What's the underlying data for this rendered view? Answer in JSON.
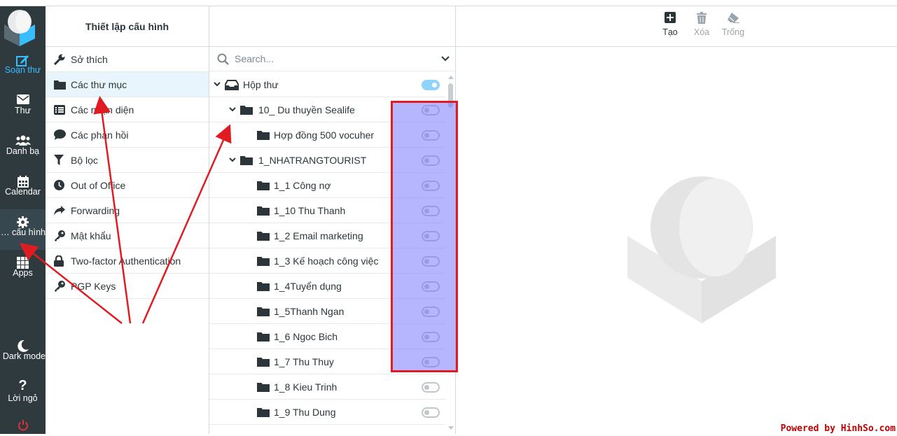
{
  "nav": {
    "items": [
      {
        "label": "Soạn thư",
        "icon": "compose-icon"
      },
      {
        "label": "Thư",
        "icon": "mail-icon"
      },
      {
        "label": "Danh bạ",
        "icon": "contacts-icon"
      },
      {
        "label": "Calendar",
        "icon": "calendar-icon"
      },
      {
        "label": "Thiết lập cấu hình",
        "icon": "gear-icon"
      },
      {
        "label": "Apps",
        "icon": "apps-icon"
      }
    ],
    "dark_mode": "Dark mode",
    "help": "Lời ngỏ",
    "logout_icon": "power-icon"
  },
  "settings": {
    "title": "Thiết lập cấu hình",
    "items": [
      {
        "label": "Sở thích",
        "icon": "wrench-icon"
      },
      {
        "label": "Các thư mục",
        "icon": "folder-icon"
      },
      {
        "label": "Các nhận diện",
        "icon": "identity-list-icon"
      },
      {
        "label": "Các phản hồi",
        "icon": "comment-icon"
      },
      {
        "label": "Bộ lọc",
        "icon": "filter-icon"
      },
      {
        "label": "Out of Office",
        "icon": "clock-icon"
      },
      {
        "label": "Forwarding",
        "icon": "forward-icon"
      },
      {
        "label": "Mật khẩu",
        "icon": "key-icon"
      },
      {
        "label": "Two-factor Authentication",
        "icon": "lock-icon"
      },
      {
        "label": "PGP Keys",
        "icon": "key-icon"
      }
    ]
  },
  "folders": {
    "search_placeholder": "Search...",
    "rows": [
      {
        "name": "Hộp thư",
        "subscribed": true
      },
      {
        "name": "10_ Du thuyền Sealife",
        "subscribed": false
      },
      {
        "name": "Hợp đồng 500 vocuher",
        "subscribed": false
      },
      {
        "name": "1_NHATRANGTOURIST",
        "subscribed": false
      },
      {
        "name": "1_1 Công nợ",
        "subscribed": false
      },
      {
        "name": "1_10 Thu Thanh",
        "subscribed": false
      },
      {
        "name": "1_2 Email marketing",
        "subscribed": false
      },
      {
        "name": "1_3 Kế hoạch công việc",
        "subscribed": false
      },
      {
        "name": "1_4Tuyển dụng",
        "subscribed": false
      },
      {
        "name": "1_5Thanh Ngan",
        "subscribed": false
      },
      {
        "name": "1_6 Ngoc Bich",
        "subscribed": false
      },
      {
        "name": "1_7 Thu Thuy",
        "subscribed": false
      },
      {
        "name": "1_8 Kieu Trinh",
        "subscribed": false
      },
      {
        "name": "1_9 Thu Dung",
        "subscribed": false
      }
    ]
  },
  "toolbar": {
    "create": "Tạo",
    "delete": "Xóa",
    "empty": "Trống"
  },
  "colors": {
    "nav_bg": "#2f3a3f",
    "accent": "#37beff",
    "annotation": "#e11b22"
  },
  "watermark": "Powered by HinhSo.com"
}
